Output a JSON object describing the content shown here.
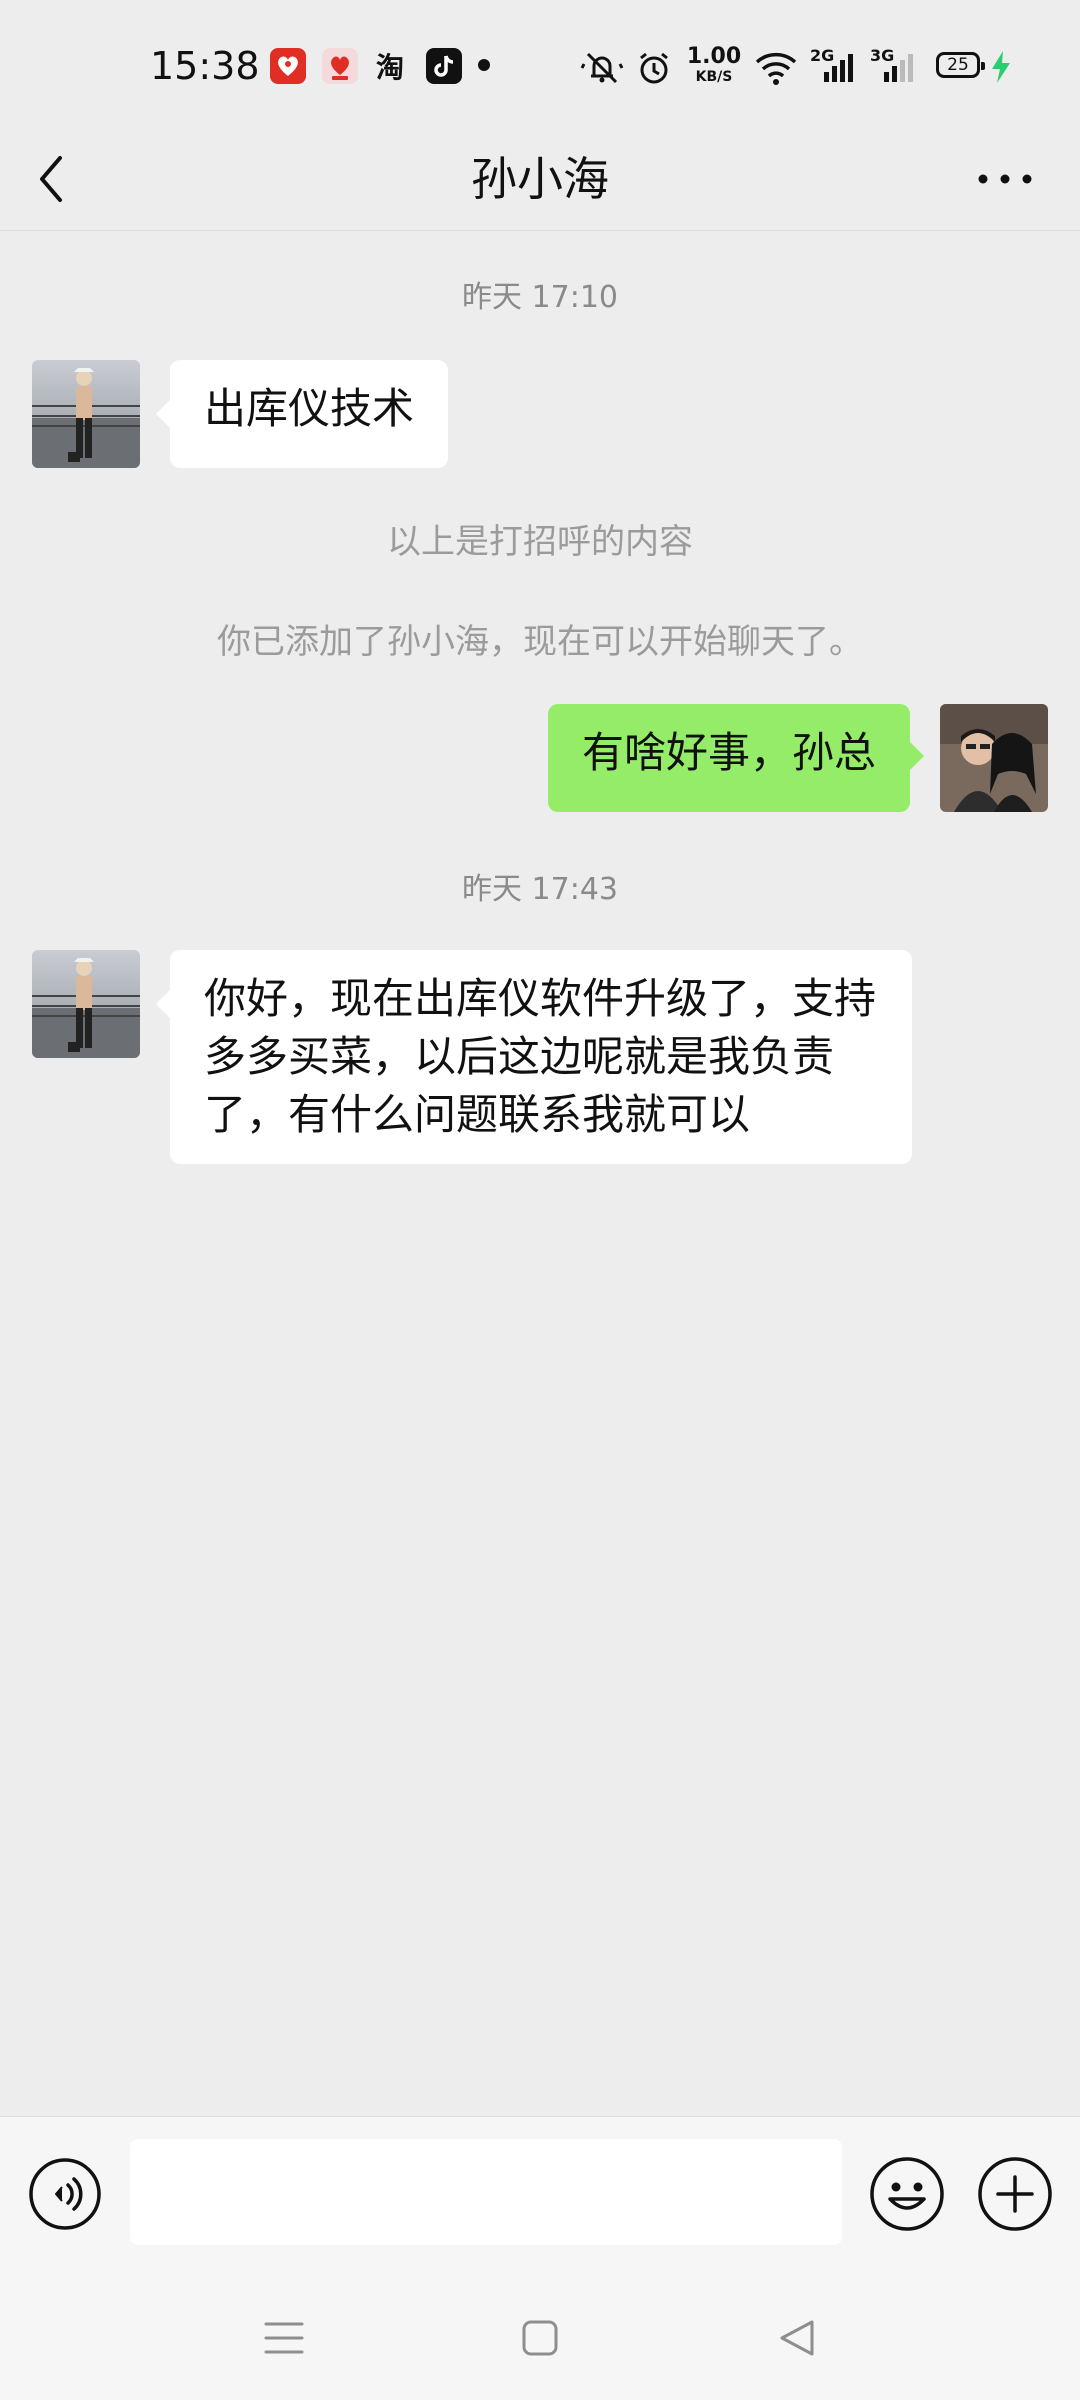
{
  "status_bar": {
    "time": "15:38",
    "app_icons": [
      "pinduoduo-icon",
      "pinduoduo-shop-icon",
      "taobao-icon",
      "tiktok-icon"
    ],
    "taobao_label": "淘",
    "net_speed_value": "1.00",
    "net_speed_unit": "KB/S",
    "signal_1_label": "2G",
    "signal_2_label": "3G",
    "battery_level": "25"
  },
  "header": {
    "title": "孙小海"
  },
  "messages": [
    {
      "type": "timestamp",
      "text": "昨天 17:10"
    },
    {
      "type": "received",
      "text": "出库仪技术"
    },
    {
      "type": "system",
      "text": "以上是打招呼的内容"
    },
    {
      "type": "system",
      "text": "你已添加了孙小海，现在可以开始聊天了。"
    },
    {
      "type": "sent",
      "text": "有啥好事，孙总"
    },
    {
      "type": "timestamp",
      "text": "昨天 17:43"
    },
    {
      "type": "received",
      "text": "你好，现在出库仪软件升级了，支持多多买菜，以后这边呢就是我负责了，有什么问题联系我就可以"
    }
  ],
  "input": {
    "value": "",
    "placeholder": ""
  },
  "colors": {
    "background": "#ededed",
    "sent_bubble": "#95ec69",
    "received_bubble": "#ffffff",
    "input_bar": "#f6f6f6"
  }
}
